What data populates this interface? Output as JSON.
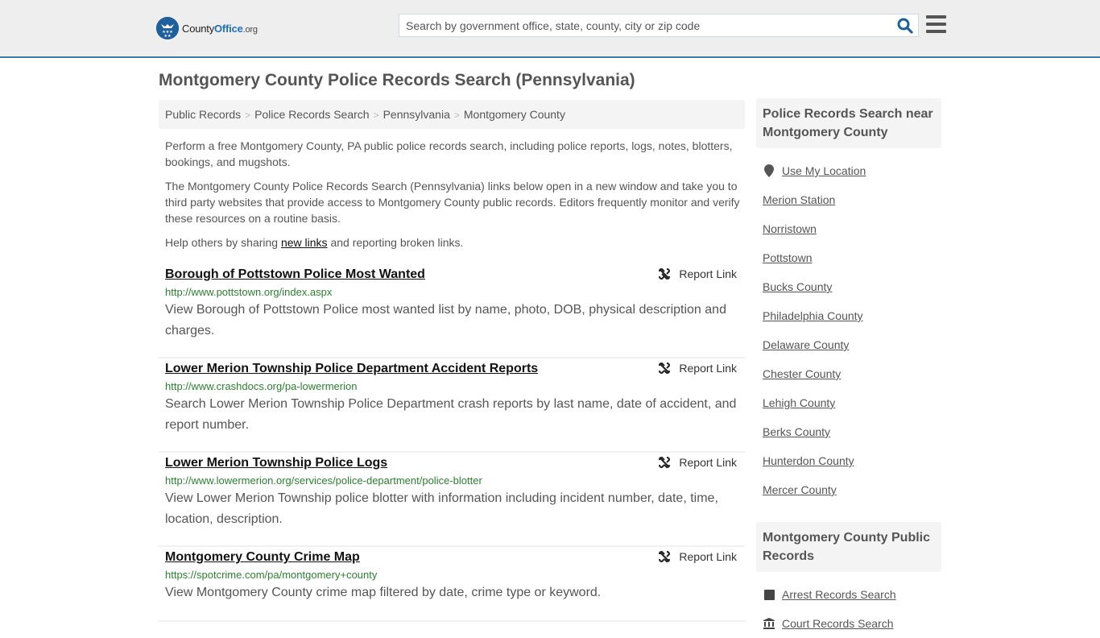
{
  "header": {
    "logo": {
      "name": "County",
      "office": "Office",
      "tld": ".org"
    },
    "search": {
      "placeholder": "Search by government office, state, county, city or zip code",
      "value": ""
    },
    "search_icon": "search-icon",
    "menu_icon": "hamburger-menu-icon"
  },
  "page": {
    "title": "Montgomery County Police Records Search (Pennsylvania)"
  },
  "breadcrumb": [
    {
      "label": "Public Records"
    },
    {
      "label": "Police Records Search"
    },
    {
      "label": "Pennsylvania"
    },
    {
      "label": "Montgomery County"
    }
  ],
  "intro": {
    "p1": "Perform a free Montgomery County, PA public police records search, including police reports, logs, notes, blotters, bookings, and mugshots.",
    "p2": "The Montgomery County Police Records Search (Pennsylvania) links below open in a new window and take you to third party websites that provide access to Montgomery County public records. Editors frequently monitor and verify these resources on a routine basis.",
    "p3_before": "Help others by sharing ",
    "p3_link": "new links",
    "p3_after": " and reporting broken links."
  },
  "results": [
    {
      "title": "Borough of Pottstown Police Most Wanted",
      "url": "http://www.pottstown.org/index.aspx",
      "description": "View Borough of Pottstown Police most wanted list by name, photo, DOB, physical description and charges.",
      "report_label": "Report Link"
    },
    {
      "title": "Lower Merion Township Police Department Accident Reports",
      "url": "http://www.crashdocs.org/pa-lowermerion",
      "description": "Search Lower Merion Township Police Department crash reports by last name, date of accident, and report number.",
      "report_label": "Report Link"
    },
    {
      "title": "Lower Merion Township Police Logs",
      "url": "http://www.lowermerion.org/services/police-department/police-blotter",
      "description": "View Lower Merion Township police blotter with information including incident number, date, time, location, description.",
      "report_label": "Report Link"
    },
    {
      "title": "Montgomery County Crime Map",
      "url": "https://spotcrime.com/pa/montgomery+county",
      "description": "View Montgomery County crime map filtered by date, crime type or keyword.",
      "report_label": "Report Link"
    }
  ],
  "sidebar": {
    "nearby": {
      "heading": "Police Records Search near Montgomery County",
      "use_location": "Use My Location",
      "items": [
        "Merion Station",
        "Norristown",
        "Pottstown",
        "Bucks County",
        "Philadelphia County",
        "Delaware County",
        "Chester County",
        "Lehigh County",
        "Berks County",
        "Hunterdon County",
        "Mercer County"
      ]
    },
    "public_records": {
      "heading": "Montgomery County Public Records",
      "items": [
        {
          "label": "Arrest Records Search",
          "icon": "square-icon"
        },
        {
          "label": "Court Records Search",
          "icon": "courthouse-icon"
        }
      ]
    }
  }
}
